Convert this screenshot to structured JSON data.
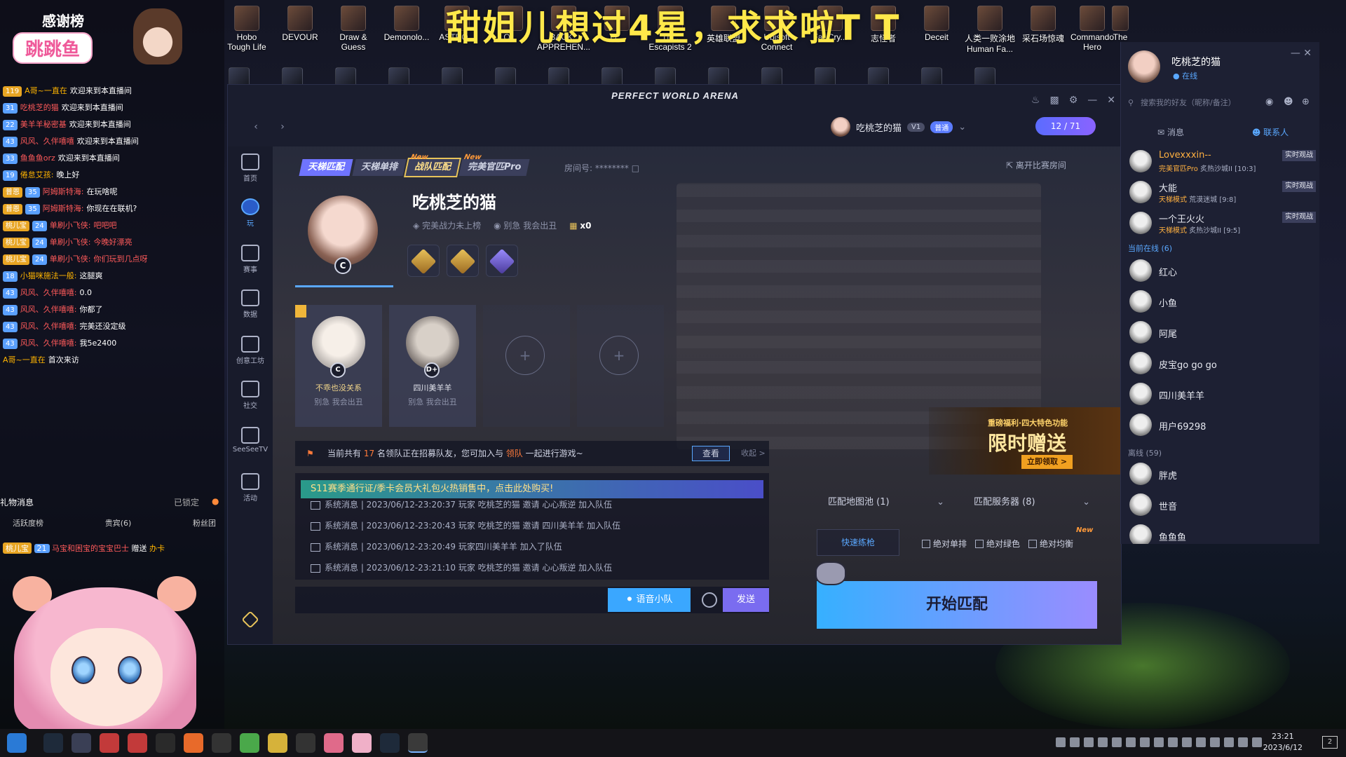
{
  "desktop": {
    "banner": "甜姐儿想过4星，求求啦T T",
    "icons": [
      {
        "label": "Hobo\nTough Life"
      },
      {
        "label": "DEVOUR"
      },
      {
        "label": "Draw &\nGuess"
      },
      {
        "label": "Demonolo..."
      },
      {
        "label": "ASTRO..."
      },
      {
        "label": "Q..."
      },
      {
        "label": "BACK..\nAPPREHEN..."
      },
      {
        "label": "Q..."
      },
      {
        "label": "Th...\nEscapists 2"
      },
      {
        "label": "英雄联盟"
      },
      {
        "label": "Ubisoft\nConnect"
      },
      {
        "label": "Far Cry..."
      },
      {
        "label": "志怪者"
      },
      {
        "label": "Deceit"
      },
      {
        "label": "人类一败涂地\nHuman Fa..."
      },
      {
        "label": "采石场惊魂"
      },
      {
        "label": "Commando\nHero"
      },
      {
        "label": "The"
      }
    ]
  },
  "overlay": {
    "title": "感谢榜",
    "streamer_tag": "跳跳鱼",
    "chat": [
      {
        "badge": "119",
        "level": "",
        "name": "A哥~一直在",
        "msg": "欢迎来到本直播间"
      },
      {
        "badge": "",
        "level": "31",
        "name": "吃桃芝的猫",
        "msg": "欢迎来到本直播间"
      },
      {
        "badge": "",
        "level": "22",
        "name": "美羊羊秘密基",
        "msg": "欢迎来到本直播间"
      },
      {
        "badge": "",
        "level": "43",
        "name": "风风、久伴嘻嘻",
        "msg": "欢迎来到本直播间"
      },
      {
        "badge": "",
        "level": "33",
        "name": "鱼鱼鱼orz",
        "msg": "欢迎来到本直播间"
      },
      {
        "badge": "",
        "level": "19",
        "name": "倦怠艾孩:",
        "msg": "晚上好"
      },
      {
        "badge": "普恩",
        "level": "35",
        "name": "阿姆斯特海:",
        "msg": "在玩啥呢"
      },
      {
        "badge": "普恩",
        "level": "35",
        "name": "阿姆斯特海:",
        "msg": "你现在在联机?"
      },
      {
        "badge": "桃儿宝",
        "level": "24",
        "name": "单刷小飞侠:",
        "msg": "吧吧吧"
      },
      {
        "badge": "桃儿宝",
        "level": "24",
        "name": "单刷小飞侠:",
        "msg": "今晚好漂亮"
      },
      {
        "badge": "桃儿宝",
        "level": "24",
        "name": "单刷小飞侠:",
        "msg": "你们玩到几点呀"
      },
      {
        "badge": "",
        "level": "18",
        "name": "小猫咪施法一般:",
        "msg": "这腿爽"
      },
      {
        "badge": "",
        "level": "43",
        "name": "风风、久伴嘻嘻:",
        "msg": "0.0"
      },
      {
        "badge": "",
        "level": "43",
        "name": "风风、久伴嘻嘻:",
        "msg": "你都了"
      },
      {
        "badge": "",
        "level": "43",
        "name": "风风、久伴嘻嘻:",
        "msg": "完美还没定级"
      },
      {
        "badge": "",
        "level": "43",
        "name": "风风、久伴嘻嘻:",
        "msg": "我5e2400"
      },
      {
        "badge": "",
        "level": "",
        "name": "A哥~一直在",
        "msg": "首次来访"
      }
    ],
    "gift_header": "礼物消息",
    "gift_locked": "已锁定",
    "gift_tabs": [
      "活跃度榜",
      "贵宾(6)",
      "粉丝团"
    ],
    "gift_line": {
      "badge": "桃儿宝",
      "level": "21",
      "name": "马宝和困宝的宝宝巴士",
      "action": "赠送",
      "item": "办卡"
    }
  },
  "app": {
    "title": "PERFECT WORLD ARENA",
    "user": {
      "name": "吃桃芝的猫",
      "vip": "V1",
      "tier": "普通"
    },
    "party_count": "12 / 71",
    "sidebar": [
      {
        "label": "首页",
        "icon": "home-icon"
      },
      {
        "label": "玩",
        "icon": "play-icon"
      },
      {
        "label": "赛事",
        "icon": "trophy-icon"
      },
      {
        "label": "数据",
        "icon": "chart-icon"
      },
      {
        "label": "创意工坊",
        "icon": "workshop-icon"
      },
      {
        "label": "社交",
        "icon": "social-icon"
      },
      {
        "label": "SeeSeeTV",
        "icon": "tv-icon"
      },
      {
        "label": "活动",
        "icon": "gift-icon"
      }
    ],
    "mode_tabs": [
      {
        "label": "天梯匹配",
        "new": ""
      },
      {
        "label": "天梯单排",
        "new": ""
      },
      {
        "label": "战队匹配",
        "new": "New"
      },
      {
        "label": "完美官匹Pro",
        "new": "New"
      }
    ],
    "room_label": "房间号: ********",
    "leave_label": "离开比赛房间",
    "profile": {
      "name": "吃桃芝的猫",
      "rank": "C",
      "power": "完美战力未上榜",
      "status": "别急 我会出丑",
      "items_count": "x0"
    },
    "party": [
      {
        "name": "不乖也没关系",
        "rank": "C",
        "status": "别急 我会出丑",
        "leader": true
      },
      {
        "name": "四川美羊羊",
        "rank": "D+",
        "status": "别急 我会出丑",
        "leader": false
      }
    ],
    "recruit": {
      "prefix": "当前共有",
      "count": "17",
      "middle": "名领队正在招募队友，您可加入与",
      "link": "领队",
      "suffix": "一起进行游戏~",
      "view": "查看",
      "fold": "收起 >"
    },
    "chat_promo": "S11赛季通行证/季卡会员大礼包火热销售中，点击此处购买!",
    "system_messages": [
      "系统消息 | 2023/06/12-23:20:37 玩家 吃桃芝的猫 邀请 心心叛逆 加入队伍",
      "系统消息 | 2023/06/12-23:20:43 玩家 吃桃芝的猫 邀请 四川美羊羊 加入队伍",
      "系统消息 | 2023/06/12-23:20:49 玩家四川美羊羊 加入了队伍",
      "系统消息 | 2023/06/12-23:21:10 玩家 吃桃芝的猫 邀请 心心叛逆 加入队伍"
    ],
    "voice_btn": "语音小队",
    "send_btn": "发送",
    "ad": {
      "small": "重磅福利·四大特色功能",
      "big": "限时赠送",
      "cta": "立即领取 >"
    },
    "map_pool": "匹配地图池 (1)",
    "server": "匹配服务器 (8)",
    "quick_practice": "快速练枪",
    "checkboxes": [
      "绝对单排",
      "绝对绿色",
      "绝对均衡"
    ],
    "new_tag": "New",
    "start_btn": "开始匹配"
  },
  "friends": {
    "me": {
      "name": "吃桃芝的猫",
      "status": "在线"
    },
    "search_placeholder": "搜索我的好友（昵称/备注）",
    "tabs": [
      "消息",
      "联系人"
    ],
    "ingame": [
      {
        "name": "Lovexxxin--",
        "mode": "完美官匹Pro",
        "map": "炙热沙城II",
        "score": "10:3",
        "live": "实时观战"
      },
      {
        "name": "大能",
        "mode": "天梯模式",
        "map": "荒漠迷城",
        "score": "9:8",
        "live": "实时观战"
      },
      {
        "name": "一个王火火",
        "mode": "天梯模式",
        "map": "炙热沙城II",
        "score": "9:5",
        "live": "实时观战"
      }
    ],
    "online_label": "当前在线",
    "online_count": "(6)",
    "online": [
      "红心",
      "小鱼",
      "阿尾",
      "皮宝go go go",
      "四川美羊羊",
      "用户69298"
    ],
    "offline_label": "离线",
    "offline_count": "(59)",
    "offline": [
      "胖虎",
      "世音",
      "鱼鱼鱼"
    ]
  },
  "taskbar": {
    "time": "23:21",
    "date": "2023/6/12",
    "notifications": "2"
  }
}
